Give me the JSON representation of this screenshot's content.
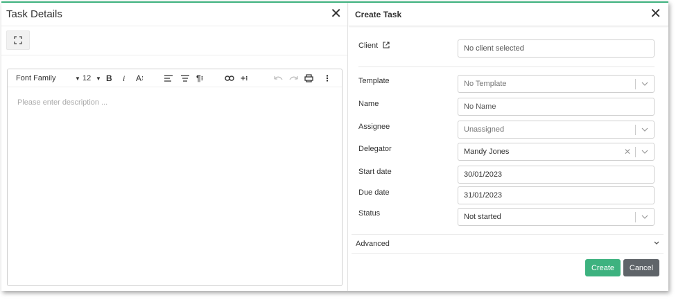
{
  "task_details": {
    "title": "Task Details",
    "close_glyph": "✕",
    "editor": {
      "font_family_label": "Font Family",
      "font_size_label": "12",
      "placeholder": "Please enter description ..."
    }
  },
  "create_task": {
    "title": "Create Task",
    "close_glyph": "✕",
    "fields": {
      "client": {
        "label": "Client",
        "value": "No client selected"
      },
      "template": {
        "label": "Template",
        "value": "No Template"
      },
      "name": {
        "label": "Name",
        "value": "No Name"
      },
      "assignee": {
        "label": "Assignee",
        "value": "Unassigned"
      },
      "delegator": {
        "label": "Delegator",
        "value": "Mandy Jones"
      },
      "start_date": {
        "label": "Start date",
        "value": "30/01/2023"
      },
      "due_date": {
        "label": "Due date",
        "value": "31/01/2023"
      },
      "status": {
        "label": "Status",
        "value": "Not started"
      }
    },
    "advanced_label": "Advanced",
    "create_label": "Create",
    "cancel_label": "Cancel"
  },
  "colors": {
    "accent": "#3db27f",
    "cancel": "#5f6469"
  }
}
